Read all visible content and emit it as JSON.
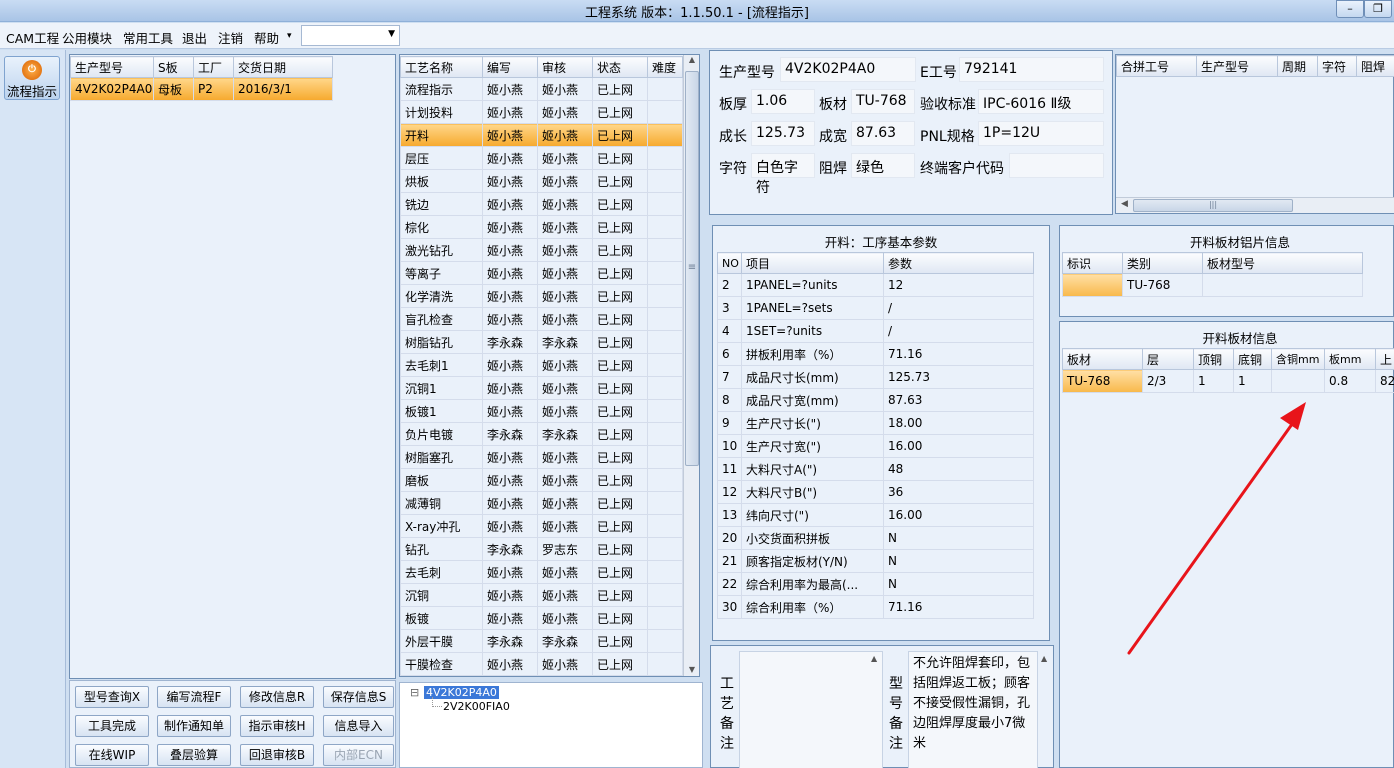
{
  "window": {
    "title": "工程系统   版本：1.1.50.1 - [流程指示]",
    "min": "–",
    "restore": "❐"
  },
  "menu": {
    "items": [
      "CAM工程",
      "公用模块",
      "常用工具",
      "退出",
      "注销",
      "帮助"
    ],
    "help_arrow": "▾",
    "combo_arrow": "▼",
    "combo_value": ""
  },
  "left": {
    "flow_button": "流程指示",
    "flow_icon": "⏻"
  },
  "orders": {
    "headers": [
      "生产型号",
      "S板",
      "工厂",
      "交货日期"
    ],
    "rows": [
      [
        "4V2K02P4A0",
        "母板",
        "P2",
        "2016/3/1"
      ]
    ]
  },
  "process": {
    "headers": [
      "工艺名称",
      "编写",
      "审核",
      "状态",
      "难度"
    ],
    "rows": [
      [
        "流程指示",
        "姬小燕",
        "姬小燕",
        "已上网",
        ""
      ],
      [
        "计划投料",
        "姬小燕",
        "姬小燕",
        "已上网",
        ""
      ],
      [
        "开料",
        "姬小燕",
        "姬小燕",
        "已上网",
        ""
      ],
      [
        "层压",
        "姬小燕",
        "姬小燕",
        "已上网",
        ""
      ],
      [
        "烘板",
        "姬小燕",
        "姬小燕",
        "已上网",
        ""
      ],
      [
        "铣边",
        "姬小燕",
        "姬小燕",
        "已上网",
        ""
      ],
      [
        "棕化",
        "姬小燕",
        "姬小燕",
        "已上网",
        ""
      ],
      [
        "激光钻孔",
        "姬小燕",
        "姬小燕",
        "已上网",
        ""
      ],
      [
        "等离子",
        "姬小燕",
        "姬小燕",
        "已上网",
        ""
      ],
      [
        "化学清洗",
        "姬小燕",
        "姬小燕",
        "已上网",
        ""
      ],
      [
        "盲孔检查",
        "姬小燕",
        "姬小燕",
        "已上网",
        ""
      ],
      [
        "树脂钻孔",
        "李永森",
        "李永森",
        "已上网",
        ""
      ],
      [
        "去毛刺1",
        "姬小燕",
        "姬小燕",
        "已上网",
        ""
      ],
      [
        "沉铜1",
        "姬小燕",
        "姬小燕",
        "已上网",
        ""
      ],
      [
        "板镀1",
        "姬小燕",
        "姬小燕",
        "已上网",
        ""
      ],
      [
        "负片电镀",
        "李永森",
        "李永森",
        "已上网",
        ""
      ],
      [
        "树脂塞孔",
        "姬小燕",
        "姬小燕",
        "已上网",
        ""
      ],
      [
        "磨板",
        "姬小燕",
        "姬小燕",
        "已上网",
        ""
      ],
      [
        "减薄铜",
        "姬小燕",
        "姬小燕",
        "已上网",
        ""
      ],
      [
        "X-ray冲孔",
        "姬小燕",
        "姬小燕",
        "已上网",
        ""
      ],
      [
        "钻孔",
        "李永森",
        "罗志东",
        "已上网",
        ""
      ],
      [
        "去毛刺",
        "姬小燕",
        "姬小燕",
        "已上网",
        ""
      ],
      [
        "沉铜",
        "姬小燕",
        "姬小燕",
        "已上网",
        ""
      ],
      [
        "板镀",
        "姬小燕",
        "姬小燕",
        "已上网",
        ""
      ],
      [
        "外层干膜",
        "李永森",
        "李永森",
        "已上网",
        ""
      ],
      [
        "干膜检查",
        "姬小燕",
        "姬小燕",
        "已上网",
        ""
      ]
    ],
    "selected_index": 2,
    "scroll_up": "▲",
    "scroll_down": "▼",
    "grip": "≡"
  },
  "buttons": [
    "型号查询X",
    "编写流程F",
    "修改信息R",
    "保存信息S",
    "工具完成",
    "制作通知单",
    "指示审核H",
    "信息导入",
    "在线WIP",
    "叠层验算",
    "回退审核B",
    "内部ECN"
  ],
  "tree": {
    "toggle": "⊟",
    "root": "4V2K02P4A0",
    "child": "2V2K00FIA0"
  },
  "info": {
    "model_lbl": "生产型号",
    "model": "4V2K02P4A0",
    "eno_lbl": "E工号",
    "eno": "792141",
    "thick_lbl": "板厚",
    "thick": "1.06",
    "mat_lbl": "板材",
    "mat": "TU-768",
    "std_lbl": "验收标准",
    "std": "IPC-6016 Ⅱ级",
    "len_lbl": "成长",
    "len": "125.73",
    "wid_lbl": "成宽",
    "wid": "87.63",
    "pnl_lbl": "PNL规格",
    "pnl": "1P=12U",
    "char_lbl": "字符",
    "char": "白色字符",
    "mask_lbl": "阻焊",
    "mask": "绿色",
    "cust_lbl": "终端客户代码",
    "cust": ""
  },
  "merge": {
    "headers": [
      "合拼工号",
      "生产型号",
      "周期",
      "字符",
      "阻焊"
    ],
    "scroll_left": "◀",
    "grip": "|||"
  },
  "params": {
    "title": "开料：工序基本参数",
    "headers": [
      "NO",
      "项目",
      "参数"
    ],
    "rows": [
      [
        "2",
        "1PANEL=?units",
        "12"
      ],
      [
        "3",
        "1PANEL=?sets",
        "/"
      ],
      [
        "4",
        "1SET=?units",
        "/"
      ],
      [
        "6",
        "拼板利用率（%）",
        "71.16"
      ],
      [
        "7",
        "成品尺寸长(mm)",
        "125.73"
      ],
      [
        "8",
        "成品尺寸宽(mm)",
        "87.63"
      ],
      [
        "9",
        "生产尺寸长(\")",
        "18.00"
      ],
      [
        "10",
        "生产尺寸宽(\")",
        "16.00"
      ],
      [
        "11",
        "大料尺寸A(\")",
        "48"
      ],
      [
        "12",
        "大料尺寸B(\")",
        "36"
      ],
      [
        "13",
        "纬向尺寸(\")",
        "16.00"
      ],
      [
        "20",
        "小交货面积拼板",
        "N"
      ],
      [
        "21",
        "顾客指定板材(Y/N)",
        "N"
      ],
      [
        "22",
        "综合利用率为最高(...",
        "N"
      ],
      [
        "30",
        "综合利用率（%）",
        "71.16"
      ]
    ]
  },
  "alu": {
    "title": "开料板材铝片信息",
    "headers": [
      "标识",
      "类别",
      "板材型号"
    ],
    "rows": [
      [
        "",
        "TU-768",
        ""
      ]
    ]
  },
  "sheet": {
    "title": "开料板材信息",
    "headers": [
      "板材",
      "层",
      "顶铜",
      "底铜",
      "含铜mm",
      "板mm",
      "上"
    ],
    "rows": [
      [
        "TU-768",
        "2/3",
        "1",
        "1",
        "",
        "0.8",
        "82"
      ]
    ]
  },
  "notes": {
    "proc_label": [
      "工",
      "艺",
      "备",
      "注"
    ],
    "proc_text": "",
    "model_label": [
      "型",
      "号",
      "备",
      "注"
    ],
    "model_text": "不允许阻焊套印，包括阻焊返工板；顾客不接受假性漏铜，孔边阻焊厚度最小7微米",
    "up": "▲"
  },
  "colors": {
    "arrow": "#e8141a",
    "selected": "#f6a92d",
    "frame": "#cfdff1"
  }
}
